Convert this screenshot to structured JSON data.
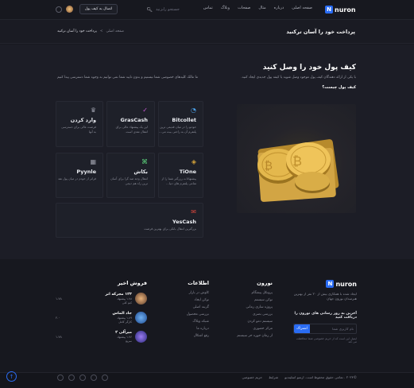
{
  "header": {
    "brand": "nuron",
    "brand_mark": "N",
    "nav": [
      "صفحه اصلی",
      "درباره",
      "مثال",
      "صفحات",
      "وبلاگ",
      "تماس"
    ],
    "search_placeholder": "جستجو رابزنید",
    "connect_wallet": "اتصال به کیف پول"
  },
  "subheader": {
    "page_title": "پرداخت خود را آسان ترکنید",
    "breadcrumb_home": "صفحه اصلی",
    "breadcrumb_sep": ">",
    "breadcrumb_current": "پرداخت خود را آسان ترکنید"
  },
  "hero": {
    "title": "کیف پول خود را وصل کنید",
    "description": "با یکی از ارائه دهندگان کیف پول موجود وصل شوید یا کیفه پول جدیدی ایجاد کنید.",
    "question": "کیف پول چیست؟",
    "side_note": "ما مالک کلیدهای خصوصی شما نیستیم و بدون تایید شما نمی توانیم به وجوه شما دسترسی پیدا کنیم"
  },
  "wallets": [
    {
      "name": "Bitcollet",
      "text": "خودتو را در میان قدیمی ترین پلتفرم آن به راحتی بیت می...",
      "icon": "bitcollet-icon",
      "icon_char": "◔",
      "color_class": "b"
    },
    {
      "name": "GrasCash",
      "text": "این یک پیشنهاد عالی برای انتقال نقدی است.",
      "icon": "grascash-icon",
      "icon_char": "✓",
      "color_class": "p"
    },
    {
      "name": "وارد کردن",
      "text": "فرصت عالی برای دسترسی به آنها",
      "icon": "medal-icon",
      "icon_char": "♛",
      "color_class": "gr"
    },
    {
      "name": "TiOne",
      "text": "پیشنهادات رزرگتر شما را از تمامی پلتفرم های دنیا...",
      "icon": "tione-icon",
      "icon_char": "◈",
      "color_class": "y"
    },
    {
      "name": "بکاش",
      "text": "انتقال وجه صد گرا برای آسان ترین راه هم دیجی",
      "icon": "bkash-icon",
      "icon_char": "⌘",
      "color_class": "g"
    },
    {
      "name": "Pyynle",
      "text": "فراتر از خودم در میان پول نقد",
      "icon": "pyynle-icon",
      "icon_char": "▦",
      "color_class": "gr"
    },
    {
      "name": "YesCash",
      "text": "بزرگترین انتقال بانکی برای بهترین فرصت",
      "icon": "yescash-icon",
      "icon_char": "✉",
      "color_class": "r"
    }
  ],
  "footer": {
    "about": "ایجاد شده با همکاری بیش از ۲۰ نفر از بهترین هنرمندان نورون جهان",
    "newsletter_title": "آخرین به روز رسانی های نورون را دریافت کنید",
    "newsletter_placeholder": "نام کاربری شما",
    "subscribe": "اشتراک",
    "privacy_note": "ایمیل این است که از حریم خصوصی شما محافظت می کند",
    "col1_title": "نورون",
    "col1_links": [
      "پروتکل پیشگام",
      "توکن سیستم",
      "پروژه سازی زمانی",
      "بررسی بصری",
      "سیستم دمو کردن",
      "مرکز حضوری",
      "از زمان حوزه حر سیستم"
    ],
    "col2_title": "اطلاعات",
    "col2_links": [
      "کاوش در بازار",
      "توکن ایجاد",
      "گزینه اصلی",
      "بررسی محصول",
      "شبکه وبلاگ",
      "درباره ما",
      "رفع اشکال"
    ],
    "col3_title": "فروش اخیر",
    "sales": [
      {
        "name": "۱۲۳ مجرکه اتر",
        "meta": "۱.۷۸ پیشنهاد",
        "meta2": "کیم کلی",
        "price": "۱.۷۸"
      },
      {
        "name": "جاد الماس",
        "meta": "۱.۸۹ پیشنهاد",
        "meta2": "کارگر کامل",
        "price": "۲.۰"
      },
      {
        "name": "میرآلی ۲",
        "meta": "۱.۷۶ پیشنهاد",
        "meta2": "سریع",
        "price": "۱.۷۸"
      }
    ]
  },
  "bottom": {
    "copyright": "©۲۰۲۳ . تمامی حقوق محفوظ است. ارسو اسلیندیو",
    "links": [
      "شرایط",
      "حریم خصوصی"
    ]
  }
}
